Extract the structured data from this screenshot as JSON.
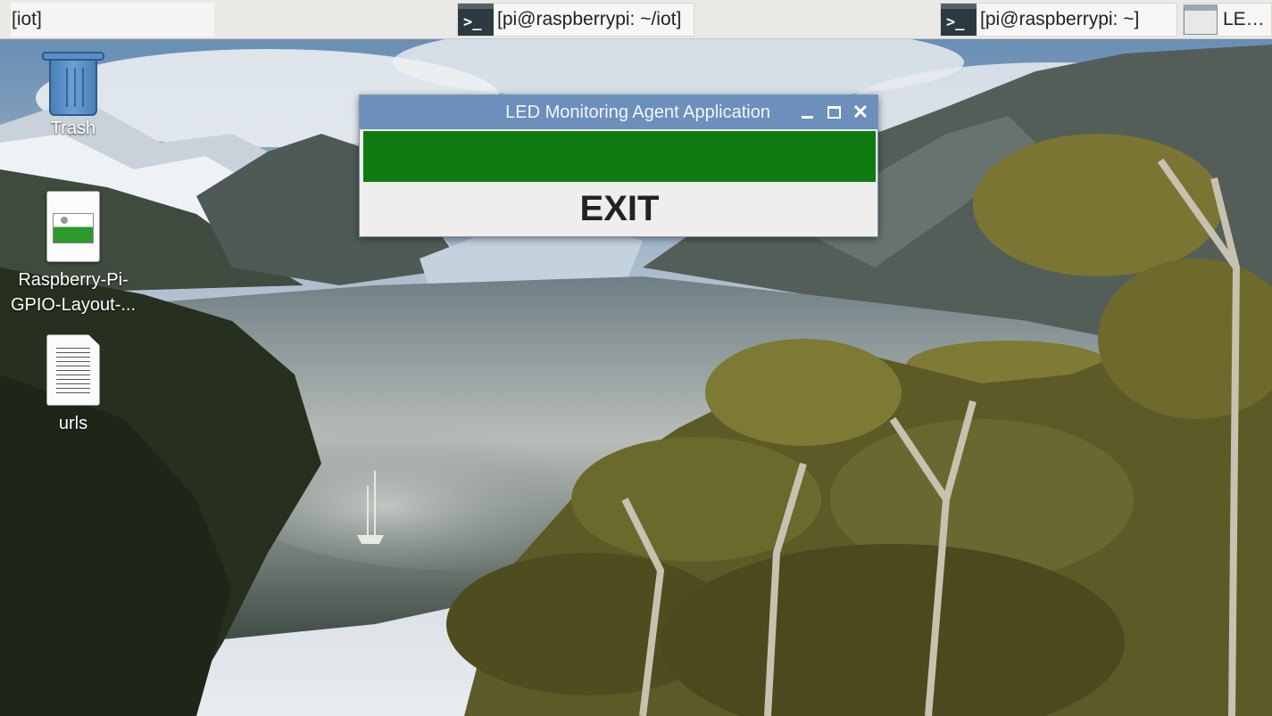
{
  "taskbar": {
    "tasks": [
      {
        "label": "[iot]",
        "icon": "folder-window"
      },
      {
        "label": "[pi@raspberrypi: ~/iot]",
        "icon": "terminal-icon"
      },
      {
        "label": "[pi@raspberrypi: ~]",
        "icon": "terminal-icon"
      },
      {
        "label": "LE… M",
        "icon": "window-icon"
      }
    ],
    "terminal_glyph": ">_"
  },
  "desktop": {
    "icons": [
      {
        "label": "Trash",
        "icon": "trash-icon"
      },
      {
        "label": "Raspberry-Pi-GPIO-Layout-...",
        "icon": "image-file-icon"
      },
      {
        "label": "urls",
        "icon": "text-file-icon"
      }
    ]
  },
  "app_window": {
    "title": "LED Monitoring Agent Application",
    "led_color": "#0f7a12",
    "exit_label": "EXIT",
    "controls": [
      "minimize-icon",
      "maximize-icon",
      "close-icon"
    ],
    "close_glyph": "✕"
  },
  "colors": {
    "titlebar": "#6c8fbb",
    "taskbar": "#ebe9e6"
  }
}
